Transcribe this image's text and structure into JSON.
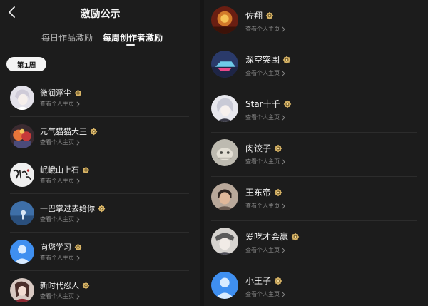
{
  "header": {
    "title": "激励公示",
    "back_icon": "back-arrow-icon"
  },
  "tabs": [
    {
      "label": "每日作品激励",
      "active": false
    },
    {
      "label": "每周创作者激励",
      "active": true
    }
  ],
  "week_label": "第1周",
  "profile_link_label": "查看个人主页",
  "left_list": [
    {
      "name": "微润浮尘",
      "badge": "gold-badge-icon"
    },
    {
      "name": "元气猫猫大王",
      "badge": "gold-badge-icon"
    },
    {
      "name": "岷峨山上石",
      "badge": "gold-badge-icon"
    },
    {
      "name": "一巴掌过去给你",
      "badge": "gold-badge-icon"
    },
    {
      "name": "向您学习",
      "badge": "gold-badge-icon"
    },
    {
      "name": "新时代忍人",
      "badge": "gold-badge-icon"
    }
  ],
  "right_list": [
    {
      "name": "佐翔",
      "badge": "gold-badge-icon"
    },
    {
      "name": "深空突围",
      "badge": "gold-badge-icon"
    },
    {
      "name": "Star十千",
      "badge": "gold-badge-icon"
    },
    {
      "name": "肉饺子",
      "badge": "gold-badge-icon"
    },
    {
      "name": "王东帝",
      "badge": "gold-badge-icon"
    },
    {
      "name": "爱吃才会赢",
      "badge": "gold-badge-icon"
    },
    {
      "name": "小王子",
      "badge": "gold-badge-icon"
    }
  ],
  "colors": {
    "background": "#1c1c1c",
    "badge_gold": "#d8b466",
    "text_primary": "#f2f2f2",
    "text_secondary": "#8a8a8a"
  }
}
